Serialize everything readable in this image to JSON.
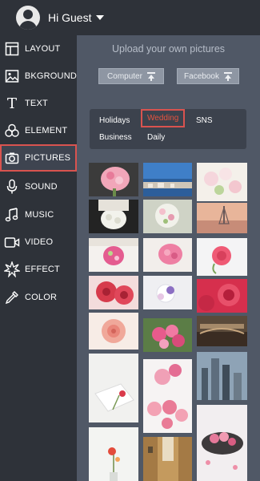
{
  "header": {
    "greeting": "Hi Guest"
  },
  "sidebar": {
    "items": [
      {
        "label": "LAYOUT",
        "icon": "layout-icon"
      },
      {
        "label": "BKGROUND",
        "icon": "image-icon"
      },
      {
        "label": "TEXT",
        "icon": "text-icon"
      },
      {
        "label": "ELEMENT",
        "icon": "element-icon"
      },
      {
        "label": "PICTURES",
        "icon": "camera-icon",
        "active": true
      },
      {
        "label": "SOUND",
        "icon": "microphone-icon"
      },
      {
        "label": "MUSIC",
        "icon": "music-note-icon"
      },
      {
        "label": "VIDEO",
        "icon": "video-camera-icon"
      },
      {
        "label": "EFFECT",
        "icon": "sparkle-icon"
      },
      {
        "label": "COLOR",
        "icon": "eyedropper-icon"
      }
    ]
  },
  "upload": {
    "title": "Upload your own pictures",
    "computer_label": "Computer",
    "facebook_label": "Facebook"
  },
  "tags": {
    "holidays": "Holidays",
    "wedding": "Wedding",
    "sns": "SNS",
    "business": "Business",
    "daily": "Daily",
    "selected": "Wedding"
  },
  "colors": {
    "sidebar_bg": "#2e3239",
    "panel_bg": "#505866",
    "accent": "#d9534f"
  },
  "photos": [
    "pink-rose-bouquet",
    "harbor-city-view",
    "white-roses",
    "bride-holding-bouquet",
    "white-rose-bouquet",
    "eiffel-tower-sunset",
    "pink-bouquet-bride",
    "rose-bouquet-bride",
    "single-pink-rose",
    "red-flowers",
    "bride-bouquet-purple",
    "red-rose-closeup",
    "peach-rose",
    "pink-roses-basket",
    "river-city-bridge",
    "gift-box-flower",
    "pink-roses-and-cakes",
    "city-skyline",
    "vase-with-flowers",
    "european-street",
    "rose-petals-bowl"
  ]
}
